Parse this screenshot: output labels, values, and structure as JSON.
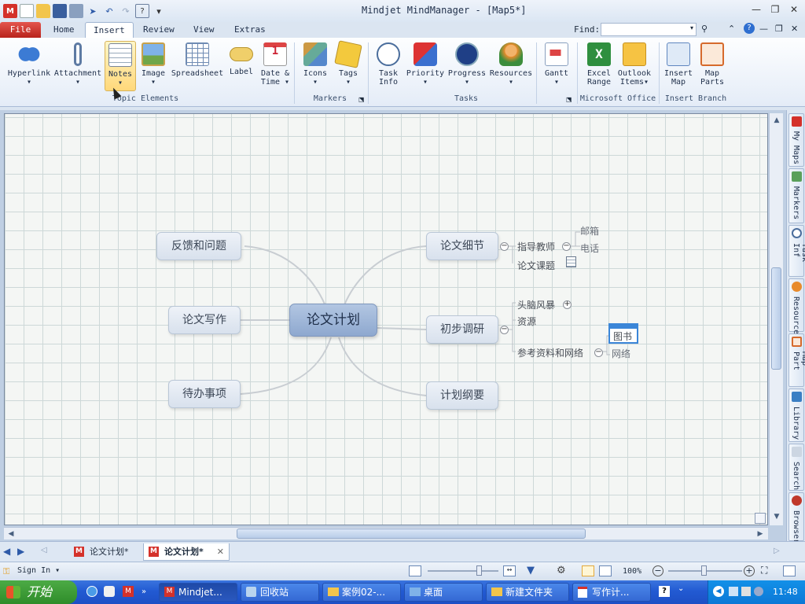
{
  "window": {
    "title": "Mindjet MindManager - [Map5*]"
  },
  "ribbon_tabs": [
    "File",
    "Home",
    "Insert",
    "Review",
    "View",
    "Extras"
  ],
  "active_tab": "Insert",
  "find": {
    "label": "Find:",
    "value": ""
  },
  "ribbon": {
    "topic_elements": {
      "buttons": [
        {
          "label": "Hyperlink",
          "icon": "hyperlink-icon"
        },
        {
          "label": "Attachment",
          "icon": "paperclip-icon"
        },
        {
          "label": "Notes",
          "icon": "notes-icon",
          "hovered": true
        },
        {
          "label": "Image",
          "icon": "image-icon"
        },
        {
          "label": "Spreadsheet",
          "icon": "spreadsheet-icon"
        },
        {
          "label": "Label",
          "icon": "label-icon"
        },
        {
          "label": "Date &",
          "label2": "Time",
          "icon": "calendar-icon"
        }
      ],
      "group_label": "Topic Elements"
    },
    "markers": {
      "buttons": [
        {
          "label": "Icons"
        },
        {
          "label": "Tags"
        }
      ],
      "group_label": "Markers"
    },
    "tasks": {
      "buttons": [
        {
          "label": "Task",
          "label2": "Info"
        },
        {
          "label": "Priority"
        },
        {
          "label": "Progress"
        },
        {
          "label": "Resources"
        },
        {
          "label": "Gantt"
        }
      ],
      "group_label": "Tasks"
    },
    "office": {
      "buttons": [
        {
          "label": "Excel",
          "label2": "Range"
        },
        {
          "label": "Outlook",
          "label2": "Items"
        }
      ],
      "group_label": "Microsoft Office"
    },
    "insert_branch": {
      "buttons": [
        {
          "label": "Insert",
          "label2": "Map"
        },
        {
          "label": "Map",
          "label2": "Parts"
        }
      ],
      "group_label": "Insert Branch"
    }
  },
  "map": {
    "central": "论文计划",
    "left_topics": [
      "反馈和问题",
      "论文写作",
      "待办事项"
    ],
    "right_topics": [
      "论文细节",
      "初步调研",
      "计划纲要"
    ],
    "detail_sub": [
      "指导教师",
      "论文课题"
    ],
    "teacher_sub": [
      "邮箱",
      "电话"
    ],
    "research_sub": [
      "头脑风暴",
      "资源",
      "参考资料和网络"
    ],
    "reference_sub": [
      "图书",
      "网络"
    ]
  },
  "side_tabs": [
    "My Maps",
    "Markers",
    "Task Inf",
    "Resource",
    "Map Part",
    "Library",
    "Search",
    "Browser"
  ],
  "doc_tabs": [
    {
      "label": "论文计划*"
    },
    {
      "label": "论文计划*",
      "active": true
    }
  ],
  "status": {
    "sign_in": "Sign In",
    "zoom": "100%"
  },
  "taskbar": {
    "start": "开始",
    "items": [
      "Mindjet...",
      "回收站",
      "案例02-...",
      "桌面",
      "新建文件夹",
      "写作计..."
    ],
    "time": "11:48"
  }
}
